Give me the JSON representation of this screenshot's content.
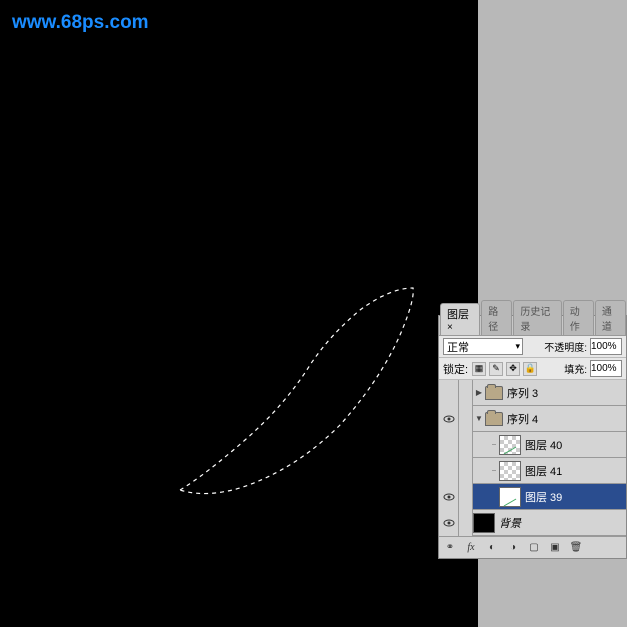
{
  "watermark": "www.68ps.com",
  "panel": {
    "tabs": [
      "图层",
      "路径",
      "历史记录",
      "动作",
      "通道"
    ],
    "active_tab": 0,
    "blend_mode": "正常",
    "opacity_label": "不透明度:",
    "opacity_value": "100%",
    "lock_label": "锁定:",
    "fill_label": "填充:",
    "fill_value": "100%",
    "layers": [
      {
        "type": "group",
        "name": "序列 3",
        "visible": false,
        "expanded": false
      },
      {
        "type": "group",
        "name": "序列 4",
        "visible": true,
        "expanded": true
      },
      {
        "type": "layer",
        "name": "图层 40",
        "visible": false,
        "indent": 1,
        "checker": true,
        "linked": true
      },
      {
        "type": "layer",
        "name": "图层 41",
        "visible": false,
        "indent": 1,
        "checker": true,
        "linked": true
      },
      {
        "type": "layer",
        "name": "图层 39",
        "visible": true,
        "indent": 1,
        "checker": false,
        "selected": true
      },
      {
        "type": "layer",
        "name": "背景",
        "visible": true,
        "indent": 0,
        "bg": true,
        "italic": true
      }
    ]
  }
}
